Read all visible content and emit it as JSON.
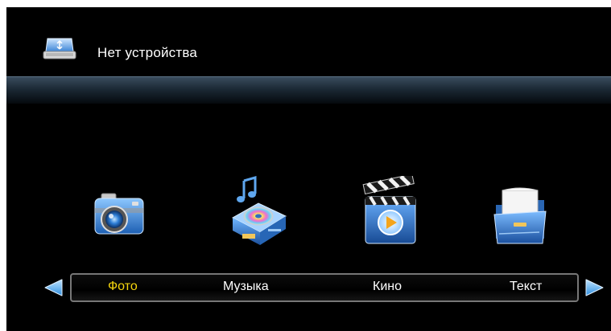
{
  "header": {
    "status_text": "Нет устройства",
    "device_icon": "usb-drive-icon"
  },
  "menu": {
    "items": [
      {
        "label": "Фото",
        "icon": "camera-icon",
        "selected": true
      },
      {
        "label": "Музыка",
        "icon": "music-box-icon",
        "selected": false
      },
      {
        "label": "Кино",
        "icon": "clapperboard-icon",
        "selected": false
      },
      {
        "label": "Текст",
        "icon": "folder-document-icon",
        "selected": false
      }
    ],
    "prev_icon": "arrow-left-icon",
    "next_icon": "arrow-right-icon"
  },
  "colors": {
    "background": "#000000",
    "selected_text": "#f5d50e",
    "text": "#ffffff",
    "icon_blue": "#2f8fe0"
  }
}
